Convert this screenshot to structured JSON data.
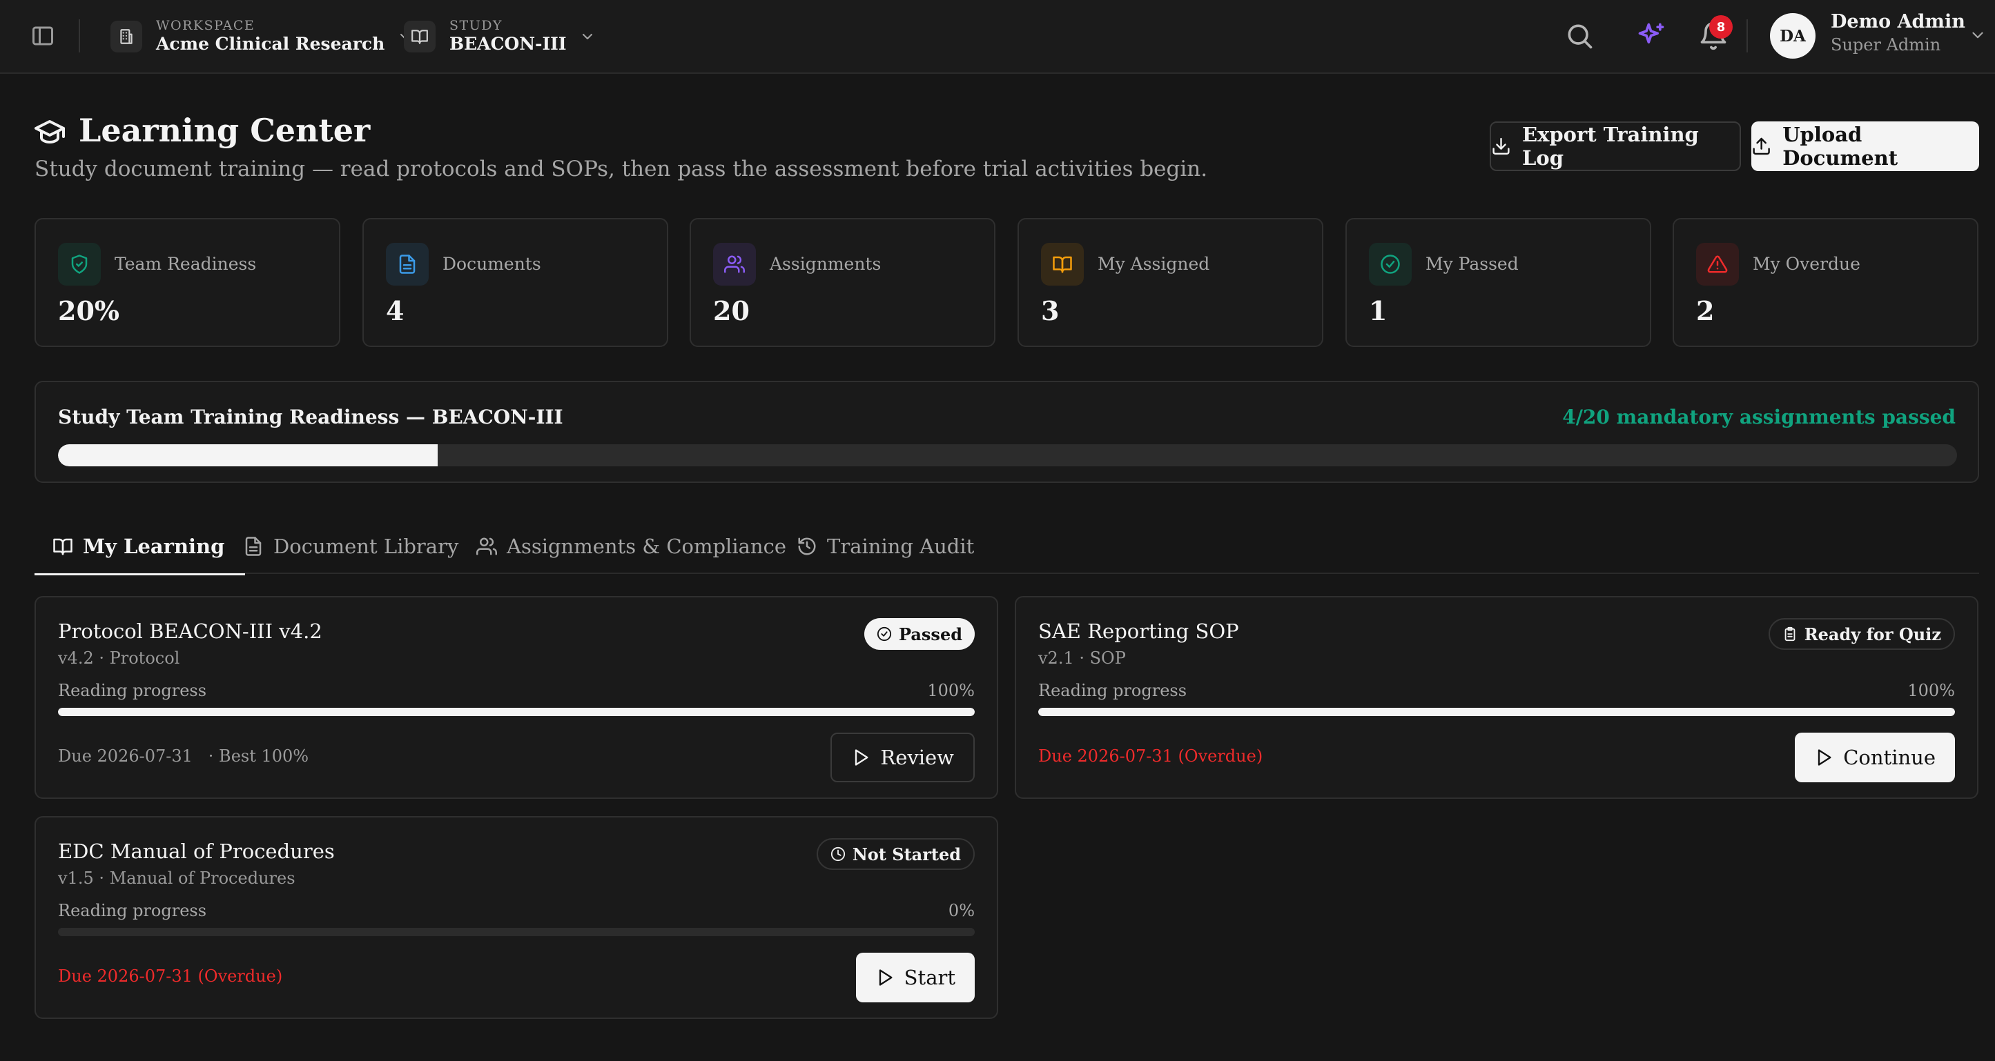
{
  "topbar": {
    "workspace": {
      "label": "WORKSPACE",
      "value": "Acme Clinical Research"
    },
    "study": {
      "label": "STUDY",
      "value": "BEACON-III"
    },
    "notifications_count": "8",
    "user": {
      "initials": "DA",
      "name": "Demo Admin",
      "role": "Super Admin"
    },
    "icons": [
      "sidebar-toggle-icon",
      "building-icon",
      "book-open-icon",
      "search-icon",
      "sparkles-icon",
      "bell-icon",
      "chevron-down-icon"
    ]
  },
  "header": {
    "title": "Learning Center",
    "subtitle": "Study document training — read protocols and SOPs, then pass the assessment before trial activities begin.",
    "export_label": "Export Training Log",
    "upload_label": "Upload Document"
  },
  "stats": [
    {
      "label": "Team Readiness",
      "value": "20%",
      "icon": "shield-check-icon",
      "color": "#10a37f"
    },
    {
      "label": "Documents",
      "value": "4",
      "icon": "file-text-icon",
      "color": "#3b9be8"
    },
    {
      "label": "Assignments",
      "value": "20",
      "icon": "users-icon",
      "color": "#8b5cf6"
    },
    {
      "label": "My Assigned",
      "value": "3",
      "icon": "book-open-icon",
      "color": "#f59e0b"
    },
    {
      "label": "My Passed",
      "value": "1",
      "icon": "check-circle-icon",
      "color": "#10a37f"
    },
    {
      "label": "My Overdue",
      "value": "2",
      "icon": "alert-triangle-icon",
      "color": "#ef2b2b"
    }
  ],
  "readiness": {
    "title": "Study Team Training Readiness — BEACON-III",
    "summary": "4/20 mandatory assignments passed",
    "progress_fraction": 0.2
  },
  "tabs": [
    {
      "label": "My Learning",
      "icon": "book-open-icon",
      "active": true
    },
    {
      "label": "Document Library",
      "icon": "file-text-icon",
      "active": false
    },
    {
      "label": "Assignments & Compliance",
      "icon": "users-icon",
      "active": false
    },
    {
      "label": "Training Audit",
      "icon": "history-icon",
      "active": false
    }
  ],
  "courses": [
    {
      "title": "Protocol BEACON-III v4.2",
      "meta": "v4.2 · Protocol",
      "status": "Passed",
      "progress_label": "Reading progress",
      "progress_text": "100%",
      "progress_fraction": 1.0,
      "due": "Due 2026-07-31   · Best 100%",
      "overdue": false,
      "action": "Review"
    },
    {
      "title": "SAE Reporting SOP",
      "meta": "v2.1 · SOP",
      "status": "Ready for Quiz",
      "progress_label": "Reading progress",
      "progress_text": "100%",
      "progress_fraction": 1.0,
      "due": "Due 2026-07-31 (Overdue)",
      "overdue": true,
      "action": "Continue"
    },
    {
      "title": "EDC Manual of Procedures",
      "meta": "v1.5 · Manual of Procedures",
      "status": "Not Started",
      "progress_label": "Reading progress",
      "progress_text": "0%",
      "progress_fraction": 0.0,
      "due": "Due 2026-07-31 (Overdue)",
      "overdue": true,
      "action": "Start"
    }
  ],
  "colors": {
    "accent_green": "#10a37f",
    "overdue_red": "#ef2b2b",
    "ai_purple": "#8b5cf6"
  }
}
